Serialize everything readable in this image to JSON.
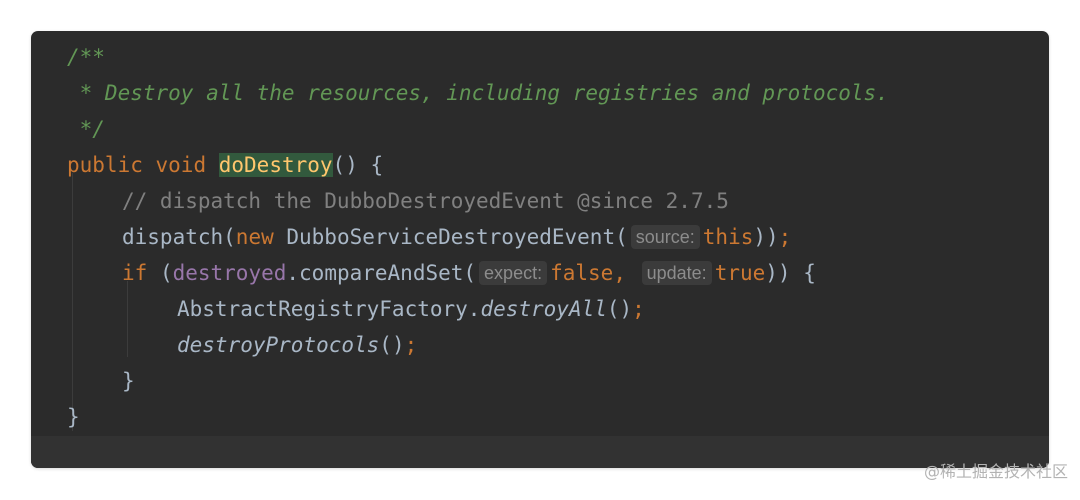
{
  "code": {
    "doc_open": "/**",
    "doc_body": " * Destroy all the resources, including registries and protocols.",
    "doc_close": " */",
    "kw_public": "public",
    "kw_void": "void",
    "method_name": "doDestroy",
    "method_tail": "() {",
    "line_comment": "// dispatch the DubboDestroyedEvent @since 2.7.5",
    "dispatch_call": "dispatch(",
    "kw_new": "new",
    "event_ctor": " DubboServiceDestroyedEvent(",
    "hint_source": "source:",
    "kw_this": "this",
    "dispatch_close": "))",
    "semicolon": ";",
    "kw_if": "if",
    "if_open": " (",
    "field_destroyed": "destroyed",
    "compare_call": ".compareAndSet(",
    "hint_expect": "expect:",
    "kw_false": "false",
    "comma": ",",
    "hint_update": "update:",
    "kw_true": "true",
    "if_close": ")) {",
    "registry_class": "AbstractRegistryFactory.",
    "destroy_all": "destroyAll",
    "parens": "()",
    "destroy_protocols": "destroyProtocols",
    "inner_close": "}",
    "outer_close": "}"
  },
  "watermark": "@稀土掘金技术社区",
  "colors": {
    "background": "#2b2b2b",
    "doc_comment": "#629755",
    "keyword": "#cc7832",
    "method_decl": "#ffc66d",
    "plain": "#a9b7c6",
    "comment": "#808080",
    "field": "#9876aa"
  }
}
